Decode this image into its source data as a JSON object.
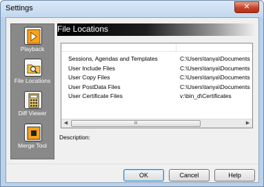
{
  "window": {
    "title": "Settings",
    "close_glyph": "✕"
  },
  "sidebar": {
    "items": [
      {
        "label": "Playback",
        "icon": "play-icon",
        "active": false
      },
      {
        "label": "File Locations",
        "icon": "folder-search-icon",
        "active": true
      },
      {
        "label": "Diff Viewer",
        "icon": "calculator-icon",
        "active": false
      },
      {
        "label": "Merge Tool",
        "icon": "merge-icon",
        "active": false
      }
    ]
  },
  "header": {
    "title": "File Locations"
  },
  "list": {
    "rows": [
      {
        "name": "Sessions, Agendas and Templates",
        "value": "C:\\Users\\tanya\\Documents"
      },
      {
        "name": "User Include Files",
        "value": "C:\\Users\\tanya\\Documents"
      },
      {
        "name": "User Copy Files",
        "value": "C:\\Users\\tanya\\Documents"
      },
      {
        "name": "User PostData Files",
        "value": "C:\\Users\\tanya\\Documents"
      },
      {
        "name": "User Certificate Files",
        "value": "v:\\bin_d\\Certificates"
      }
    ],
    "scroll_left": "◀",
    "scroll_right": "▶",
    "scroll_grip": "III"
  },
  "description": {
    "label": "Description:"
  },
  "buttons": {
    "ok": "OK",
    "cancel": "Cancel",
    "help": "Help"
  }
}
